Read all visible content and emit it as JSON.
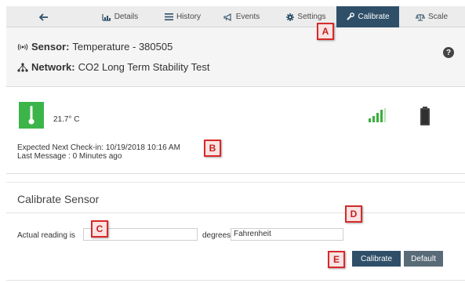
{
  "tabs": [
    {
      "label": "",
      "icon": "back-arrow-icon"
    },
    {
      "label": "Details",
      "icon": "chart-icon"
    },
    {
      "label": "History",
      "icon": "list-icon"
    },
    {
      "label": "Events",
      "icon": "bullhorn-icon"
    },
    {
      "label": "Settings",
      "icon": "gear-icon"
    },
    {
      "label": "Calibrate",
      "icon": "wrench-icon",
      "active": true
    },
    {
      "label": "Scale",
      "icon": "scale-icon"
    }
  ],
  "sensor": {
    "label": "Sensor:",
    "value": "Temperature - 380505"
  },
  "network": {
    "label": "Network:",
    "value": "CO2 Long Term Stability Test"
  },
  "help": {
    "glyph": "?"
  },
  "status": {
    "temperature": "21.7° C",
    "next_checkin": "Expected Next Check-in: 10/19/2018 10:16 AM",
    "last_message": "Last Message : 0 Minutes ago"
  },
  "calibrate": {
    "title": "Calibrate Sensor",
    "reading_label": "Actual reading is",
    "reading_value": "",
    "units_label": "degrees",
    "units_value": "Fahrenheit",
    "calibrate_button": "Calibrate",
    "default_button": "Default"
  },
  "markers": [
    "A",
    "B",
    "C",
    "D",
    "E"
  ],
  "colors": {
    "accent": "#2f4f68",
    "thermo": "#3bb54a",
    "signal": "#3cae3c",
    "marker": "#d62a2a"
  }
}
